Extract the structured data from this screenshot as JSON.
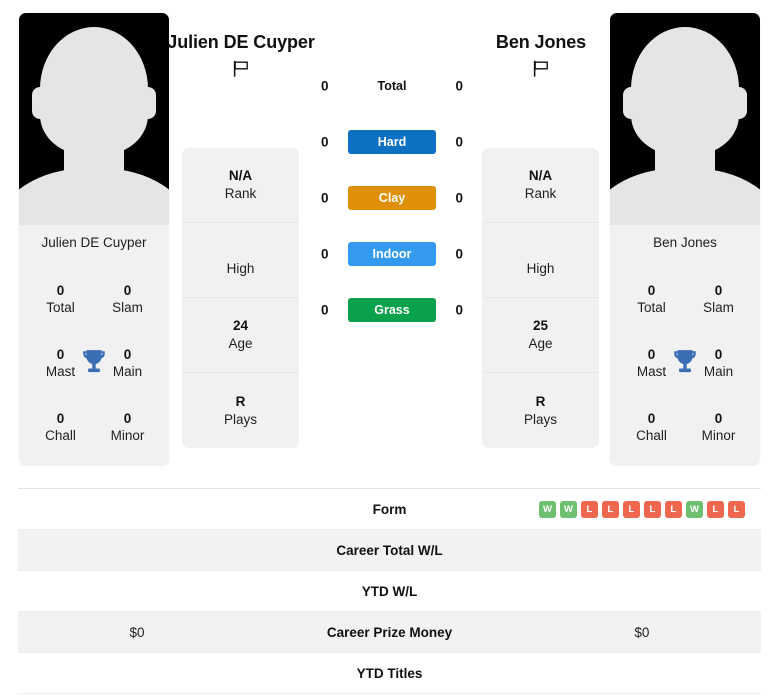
{
  "players": {
    "left": {
      "name": "Julien DE Cuyper",
      "name_display": "Julien DE Cuyper",
      "flag_icon": "flag-icon",
      "photo_caption": "Julien DE Cuyper",
      "titles": [
        {
          "value": "0",
          "label": "Total"
        },
        {
          "value": "0",
          "label": "Slam"
        },
        {
          "value": "0",
          "label": "Mast"
        },
        {
          "value": "0",
          "label": "Main"
        },
        {
          "value": "0",
          "label": "Chall"
        },
        {
          "value": "0",
          "label": "Minor"
        }
      ],
      "info": [
        {
          "value": "N/A",
          "label": "Rank"
        },
        {
          "value": "",
          "label": "High"
        },
        {
          "value": "24",
          "label": "Age"
        },
        {
          "value": "R",
          "label": "Plays"
        }
      ],
      "prize_money": "$0"
    },
    "right": {
      "name": "Ben Jones",
      "name_display": "Ben Jones",
      "flag_icon": "flag-icon",
      "photo_caption": "Ben Jones",
      "titles": [
        {
          "value": "0",
          "label": "Total"
        },
        {
          "value": "0",
          "label": "Slam"
        },
        {
          "value": "0",
          "label": "Mast"
        },
        {
          "value": "0",
          "label": "Main"
        },
        {
          "value": "0",
          "label": "Chall"
        },
        {
          "value": "0",
          "label": "Minor"
        }
      ],
      "info": [
        {
          "value": "N/A",
          "label": "Rank"
        },
        {
          "value": "",
          "label": "High"
        },
        {
          "value": "25",
          "label": "Age"
        },
        {
          "value": "R",
          "label": "Plays"
        }
      ],
      "prize_money": "$0"
    }
  },
  "surfaces": [
    {
      "label": "Total",
      "left_score": "0",
      "right_score": "0",
      "color": "none",
      "plain": true
    },
    {
      "label": "Hard",
      "left_score": "0",
      "right_score": "0",
      "color": "#0c71c3",
      "plain": false
    },
    {
      "label": "Clay",
      "left_score": "0",
      "right_score": "0",
      "color": "#df9009",
      "plain": false
    },
    {
      "label": "Indoor",
      "left_score": "0",
      "right_score": "0",
      "color": "#339af0",
      "plain": false
    },
    {
      "label": "Grass",
      "left_score": "0",
      "right_score": "0",
      "color": "#09a14b",
      "plain": false
    }
  ],
  "stats_table": {
    "rows": [
      {
        "label": "Form",
        "left": "",
        "right": "",
        "type": "form"
      },
      {
        "label": "Career Total W/L",
        "left": "",
        "right": "",
        "type": "text"
      },
      {
        "label": "YTD W/L",
        "left": "",
        "right": "",
        "type": "text"
      },
      {
        "label": "Career Prize Money",
        "left": "$0",
        "right": "$0",
        "type": "text"
      },
      {
        "label": "YTD Titles",
        "left": "",
        "right": "",
        "type": "text"
      }
    ],
    "form_right": [
      "W",
      "W",
      "L",
      "L",
      "L",
      "L",
      "L",
      "W",
      "L",
      "L"
    ]
  },
  "colors": {
    "win": "#6cc070",
    "loss": "#f0674f",
    "trophy": "#3c6eb4",
    "panel_bg": "#f1f1f1",
    "row_alt_bg": "#f2f2f2"
  }
}
